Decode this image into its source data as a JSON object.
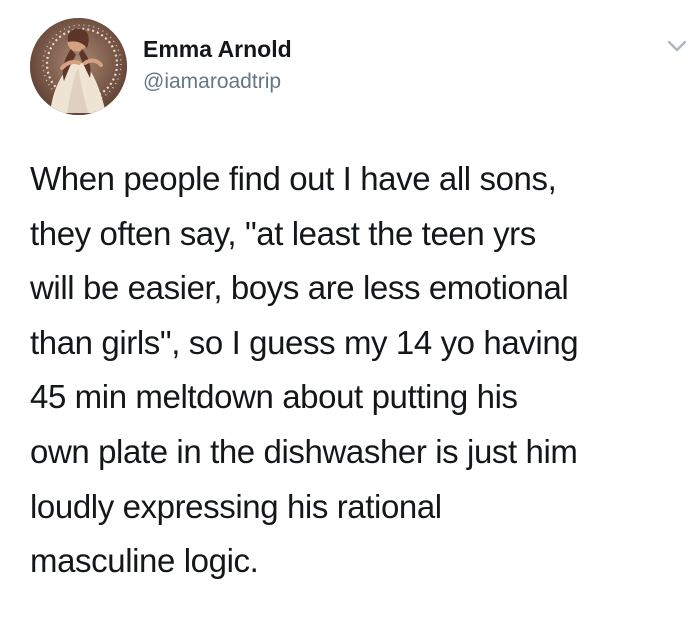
{
  "tweet": {
    "author": {
      "display_name": "Emma Arnold",
      "handle": "@iamaroadtrip",
      "avatar_icon": "profile-photo-avatar"
    },
    "menu_icon": "chevron-down-icon",
    "text": "When people find out I have all sons,\nthey often say, \"at least the teen yrs\nwill be easier, boys are less emotional\nthan girls\", so I guess my 14 yo having\n45 min meltdown about putting his\nown plate in the dishwasher is just him\nloudly expressing his rational\nmasculine logic."
  },
  "colors": {
    "text_primary": "#14171a",
    "text_secondary": "#657786",
    "caret": "#aab8c2",
    "background": "#ffffff"
  }
}
